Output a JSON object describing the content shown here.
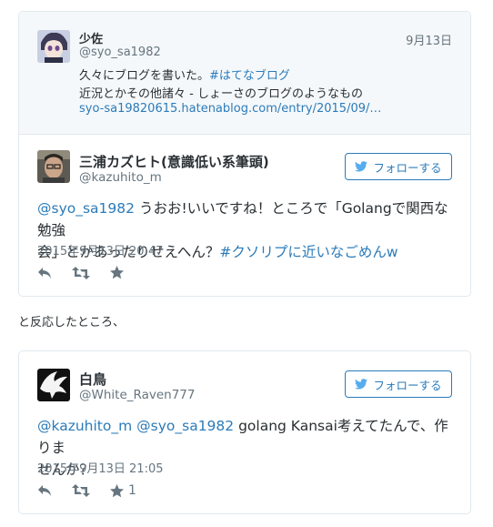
{
  "quoted": {
    "display_name": "少佐",
    "handle": "@syo_sa1982",
    "date": "9月13日",
    "line1_text": "久々にブログを書いた。",
    "line1_hashtag": "#はてなブログ",
    "line2": "近況とかその他諸々 - しょーさのブログのようなもの",
    "line3_link": "syo-sa19820615.hatenablog.com/entry/2015/09/…"
  },
  "tweet1": {
    "display_name": "三浦カズヒト(意識低い系筆頭)",
    "handle": "@kazuhito_m",
    "follow_label": "フォローする",
    "mention": "@syo_sa1982",
    "text_a": " うおお!いいですね！ところで「Golangで関西な勉強",
    "text_b": "会」とかあったりせえへん？",
    "hashtag": "#クソリプに近いなごめんw",
    "timestamp": "2015年9月13日 20:47",
    "like_count": ""
  },
  "between_text": "と反応したところ、",
  "tweet2": {
    "display_name": "白鳥",
    "handle": "@White_Raven777",
    "follow_label": "フォローする",
    "mention1": "@kazuhito_m",
    "mention2": "@syo_sa1982",
    "text_a": " golang Kansai考えてたんで、作りま",
    "text_b": "せんか？",
    "timestamp": "2015年9月13日 21:05",
    "like_count": "1"
  },
  "colors": {
    "link": "#2b7bb9",
    "muted": "#66757f",
    "border": "#e1e8ed",
    "quoted_bg": "#f5f8fa"
  },
  "icons": [
    "reply-icon",
    "retweet-icon",
    "like-icon",
    "twitter-bird-icon"
  ]
}
